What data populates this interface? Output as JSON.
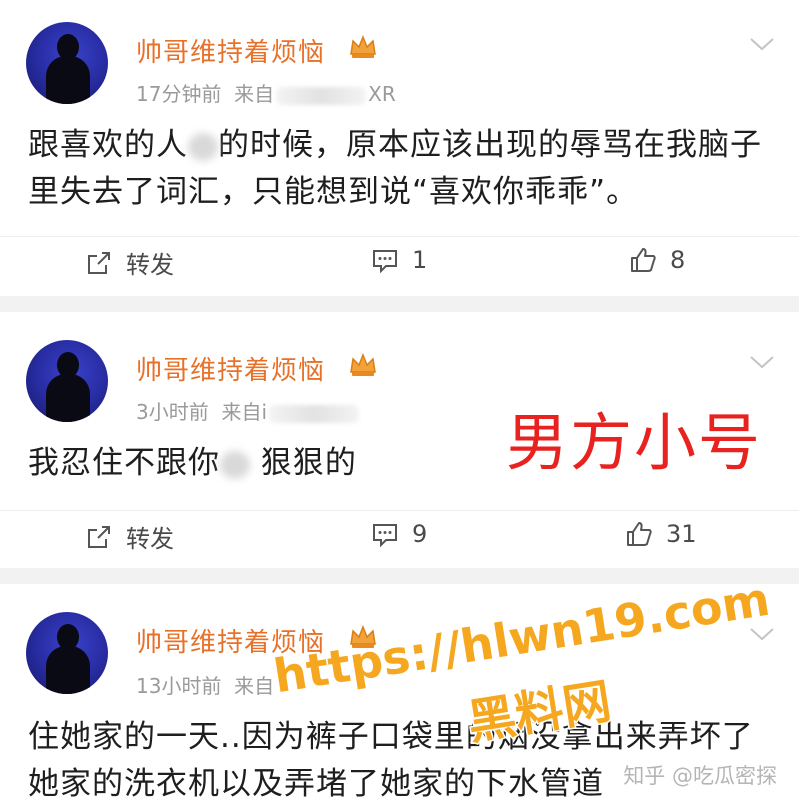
{
  "colors": {
    "username": "#e8712a",
    "meta": "#9a9a9a",
    "overlay": "#e8231f",
    "watermark": "#f5a81f"
  },
  "posts": [
    {
      "username": "帅哥维持着烦恼",
      "time": "17分钟前",
      "from_prefix": "来自",
      "from_suffix": "XR",
      "text_before": "跟喜欢的人",
      "text_after": "的时候，原本应该出现的辱骂在我脑子里失去了词汇，只能想到说“喜欢你乖乖”。",
      "repost_label": "转发",
      "comments": "1",
      "likes": "8"
    },
    {
      "username": "帅哥维持着烦恼",
      "time": "3小时前",
      "from_prefix": "来自",
      "from_suffix": "i",
      "text_before": "我忍住不跟你",
      "text_after": "  狠狠的",
      "repost_label": "转发",
      "comments": "9",
      "likes": "31"
    },
    {
      "username": "帅哥维持着烦恼",
      "time": "13小时前",
      "from_prefix": "来自",
      "from_suffix": "",
      "text_before": "住她家的一天..因为裤子口袋里的烟没拿出来弄坏了她家的洗衣机以及弄堵了她家的下水管道",
      "text_after": ""
    }
  ],
  "overlay_label": "男方小号",
  "watermark": {
    "url": "https://hlwn19.com",
    "name": "黑料网"
  },
  "credit": "知乎 @吃瓜密探",
  "icons": [
    "avatar-silhouette",
    "crown-icon",
    "chevron-down-icon",
    "repost-icon",
    "comment-icon",
    "like-icon"
  ]
}
